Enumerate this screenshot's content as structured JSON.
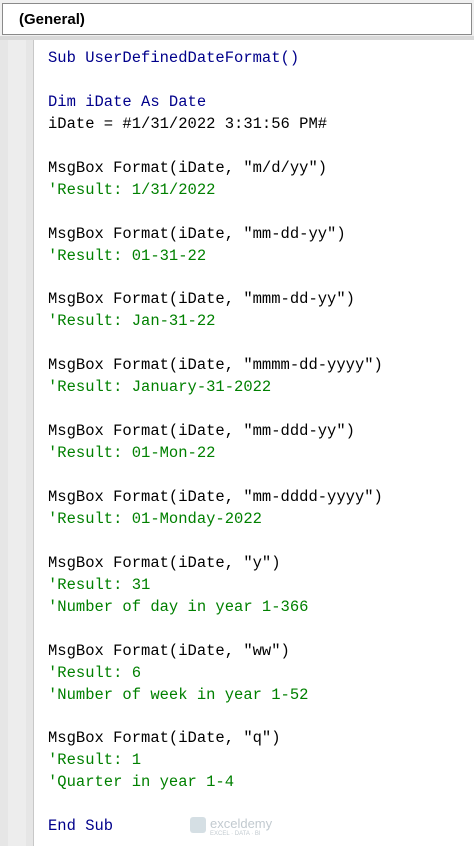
{
  "procedure_dropdown": {
    "selected": "(General)"
  },
  "code_lines": [
    {
      "type": "keyword",
      "text": "Sub UserDefinedDateFormat()"
    },
    {
      "type": "keyword",
      "text": "Dim iDate As Date"
    },
    {
      "type": "normal",
      "text": "iDate = #1/31/2022 3:31:56 PM#"
    },
    {
      "type": "normal",
      "text": "MsgBox Format(iDate, \"m/d/yy\")"
    },
    {
      "type": "comment",
      "text": "'Result: 1/31/2022"
    },
    {
      "type": "normal",
      "text": "MsgBox Format(iDate, \"mm-dd-yy\")"
    },
    {
      "type": "comment",
      "text": "'Result: 01-31-22"
    },
    {
      "type": "normal",
      "text": "MsgBox Format(iDate, \"mmm-dd-yy\")"
    },
    {
      "type": "comment",
      "text": "'Result: Jan-31-22"
    },
    {
      "type": "normal",
      "text": "MsgBox Format(iDate, \"mmmm-dd-yyyy\")"
    },
    {
      "type": "comment",
      "text": "'Result: January-31-2022"
    },
    {
      "type": "normal",
      "text": "MsgBox Format(iDate, \"mm-ddd-yy\")"
    },
    {
      "type": "comment",
      "text": "'Result: 01-Mon-22"
    },
    {
      "type": "normal",
      "text": "MsgBox Format(iDate, \"mm-dddd-yyyy\")"
    },
    {
      "type": "comment",
      "text": "'Result: 01-Monday-2022"
    },
    {
      "type": "normal",
      "text": "MsgBox Format(iDate, \"y\")"
    },
    {
      "type": "comment",
      "text": "'Result: 31"
    },
    {
      "type": "comment",
      "text": "'Number of day in year 1-366"
    },
    {
      "type": "normal",
      "text": "MsgBox Format(iDate, \"ww\")"
    },
    {
      "type": "comment",
      "text": "'Result: 6"
    },
    {
      "type": "comment",
      "text": "'Number of week in year 1-52"
    },
    {
      "type": "normal",
      "text": "MsgBox Format(iDate, \"q\")"
    },
    {
      "type": "comment",
      "text": "'Result: 1"
    },
    {
      "type": "comment",
      "text": "'Quarter in year 1-4"
    },
    {
      "type": "keyword",
      "text": "End Sub"
    }
  ],
  "watermark": {
    "name": "exceldemy",
    "tagline": "EXCEL · DATA · BI"
  },
  "colors": {
    "keyword": "#00008b",
    "comment": "#008000",
    "text": "#000000"
  }
}
